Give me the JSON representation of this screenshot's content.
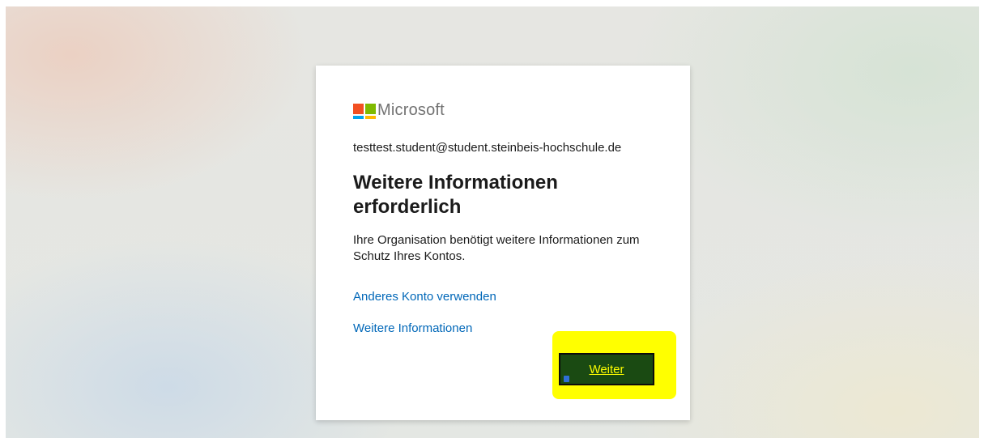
{
  "colors": {
    "link": "#0067b8",
    "button_bg": "#1a4a12",
    "button_text": "#ffff00",
    "highlight": "#ffff00"
  },
  "logo": {
    "icon": "microsoft-logo-icon",
    "text": "Microsoft"
  },
  "signin": {
    "identity": "testtest.student@student.steinbeis-hochschule.de",
    "title": "Weitere Informationen erforderlich",
    "description": "Ihre Organisation benötigt weitere Informationen zum Schutz Ihres Kontos.",
    "links": [
      {
        "label": "Anderes Konto verwenden"
      },
      {
        "label": "Weitere Informationen"
      }
    ],
    "next_button": "Weiter"
  }
}
